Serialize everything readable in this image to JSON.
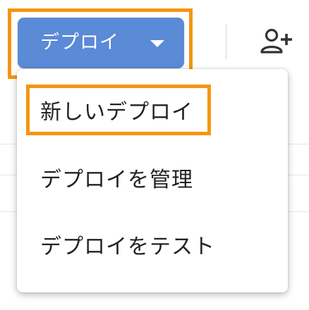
{
  "toolbar": {
    "deploy_label": "デプロイ",
    "deploy_caret_icon": "caret-down-icon",
    "share_icon": "person-add-icon"
  },
  "deploy_menu": {
    "items": [
      {
        "label": "新しいデプロイ",
        "highlighted": true
      },
      {
        "label": "デプロイを管理",
        "highlighted": false
      },
      {
        "label": "デプロイをテスト",
        "highlighted": false
      }
    ]
  },
  "colors": {
    "button_bg": "#5b8ad6",
    "highlight": "#f5950f",
    "menu_text": "#222222",
    "icon": "#333333"
  }
}
